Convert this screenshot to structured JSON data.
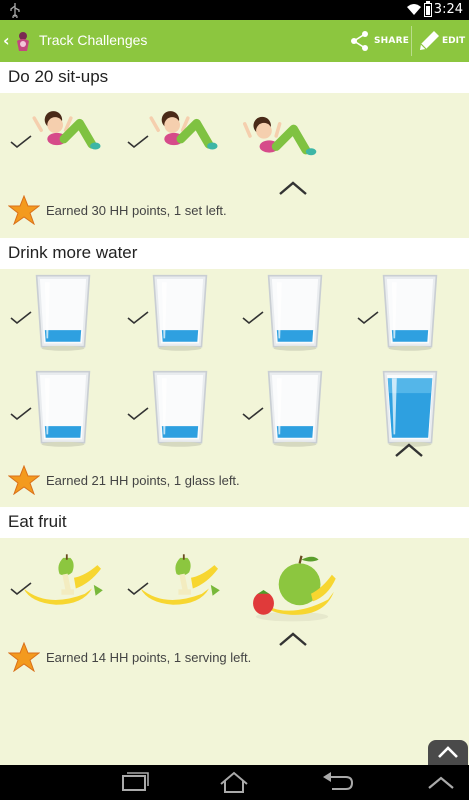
{
  "status_bar": {
    "time": "3:24",
    "icons": [
      "usb-icon",
      "wifi-icon",
      "battery-icon"
    ]
  },
  "action_bar": {
    "title": "Track Challenges",
    "share_label": "SHARE",
    "edit_label": "EDIT",
    "color": "#8cc63f"
  },
  "sections": [
    {
      "title": "Do  20  sit-ups",
      "earned_text": "Earned 30 HH points, 1 set left.",
      "items": [
        "done",
        "done",
        "current"
      ]
    },
    {
      "title": "Drink more water",
      "earned_text": "Earned 21 HH points, 1 glass left.",
      "items": [
        "done",
        "done",
        "done",
        "done",
        "done",
        "done",
        "done",
        "current"
      ]
    },
    {
      "title": "Eat fruit",
      "earned_text": "Earned 14 HH points, 1 serving left.",
      "items": [
        "done",
        "done",
        "current"
      ]
    }
  ],
  "nav_bar": {
    "buttons": [
      "recent-apps-icon",
      "home-icon",
      "back-icon",
      "hide-icon"
    ]
  }
}
